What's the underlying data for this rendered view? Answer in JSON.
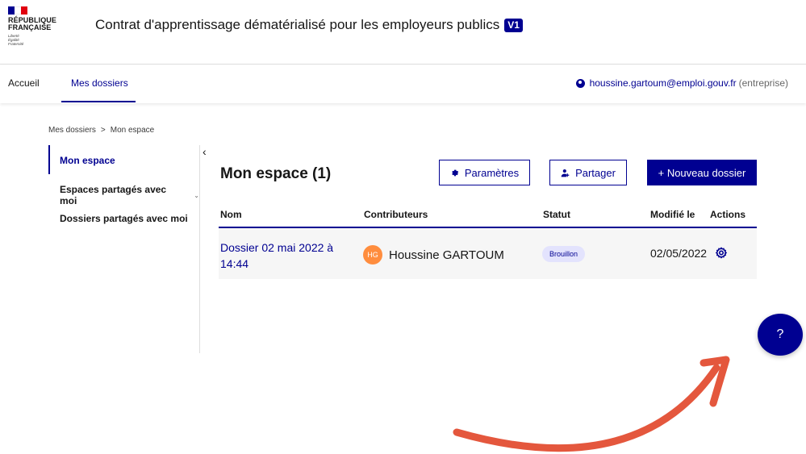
{
  "header": {
    "logo": {
      "flag_colors": [
        "#000091",
        "#ffffff",
        "#e1000f"
      ],
      "name_line1": "RÉPUBLIQUE",
      "name_line2": "FRANÇAISE",
      "devise_line1": "Liberté",
      "devise_line2": "Égalité",
      "devise_line3": "Fraternité"
    },
    "title": "Contrat d'apprentissage dématérialisé pour les employeurs publics",
    "version_badge": "V1"
  },
  "nav": {
    "items": [
      {
        "label": "Accueil",
        "active": false
      },
      {
        "label": "Mes dossiers",
        "active": true
      }
    ],
    "user_email": "houssine.gartoum@emploi.gouv.fr",
    "user_role": "(entreprise)"
  },
  "breadcrumb": {
    "items": [
      "Mes dossiers",
      "Mon espace"
    ],
    "separator": ">"
  },
  "sidebar": {
    "items": [
      {
        "label": "Mon espace",
        "active": true
      },
      {
        "label": "Espaces partagés avec moi",
        "active": false,
        "has_submenu": true
      },
      {
        "label": "Dossiers partagés avec moi",
        "active": false
      }
    ],
    "collapse_glyph": "‹"
  },
  "main": {
    "title": "Mon espace (1)",
    "buttons": {
      "parametres": "Paramètres",
      "partager": "Partager",
      "nouveau": "+ Nouveau dossier"
    },
    "table": {
      "columns": [
        "Nom",
        "Contributeurs",
        "Statut",
        "Modifié le",
        "Actions"
      ],
      "rows": [
        {
          "name": "Dossier 02 mai 2022 à 14:44",
          "contributor_initials": "HG",
          "contributor_name": "Houssine GARTOUM",
          "status": "Brouillon",
          "modified": "02/05/2022",
          "action_icon": "gear-icon"
        }
      ]
    }
  },
  "help": {
    "label": "?"
  },
  "colors": {
    "primary": "#000091",
    "accent_arrow": "#e4573d",
    "avatar": "#ff8d3e",
    "status_bg": "#e3e3fd"
  }
}
